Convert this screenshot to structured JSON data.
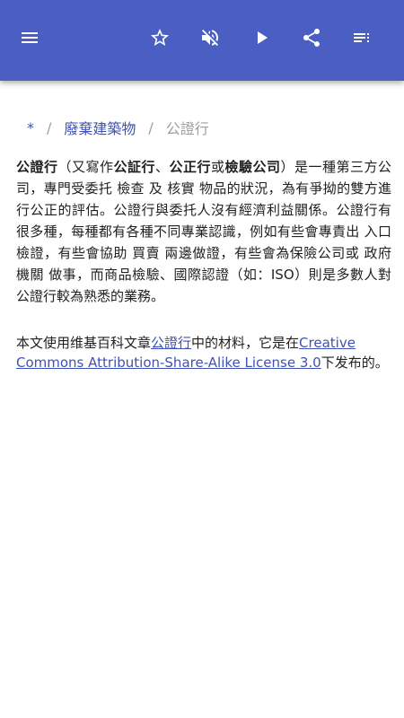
{
  "toolbar": {
    "menu_icon": "menu-icon",
    "star_icon": "star-outline-icon",
    "mute_icon": "volume-off-icon",
    "play_icon": "play-icon",
    "share_icon": "share-icon",
    "list_icon": "playlist-icon",
    "color": "#4a5fc1"
  },
  "breadcrumb": {
    "root": "*",
    "separator": "/",
    "category": "廢棄建築物",
    "current": "公證行"
  },
  "article": {
    "t1": "公證行",
    "t2": "（又寫作",
    "t3": "公証行",
    "t4": "、",
    "t5": "公正行",
    "t6": "或",
    "t7": "檢驗公司",
    "t8": "）是一種第三方公司，專門受委托 檢查 及 核實 物品的狀況，為有爭拗的雙方進行公正的評估。公證行與委托人沒有經濟利益關係。公證行有很多種，每種都有各種不同專業認識，例如有些會專責出 入口 檢證，有些會協助 買賣 兩邊做證，有些會為保險公司或 政府機關 做事，而商品檢驗、國際認證（如：ISO）則是多數人對公證行較為熟悉的業務。"
  },
  "license": {
    "prefix": "本文使用维基百科文章",
    "article_link": "公證行",
    "middle": "中的材料，它是在",
    "license_link": "Creative Commons Attribution-Share-Alike License 3.0",
    "suffix": "下发布的。",
    "link_color": "#3f51b5"
  }
}
